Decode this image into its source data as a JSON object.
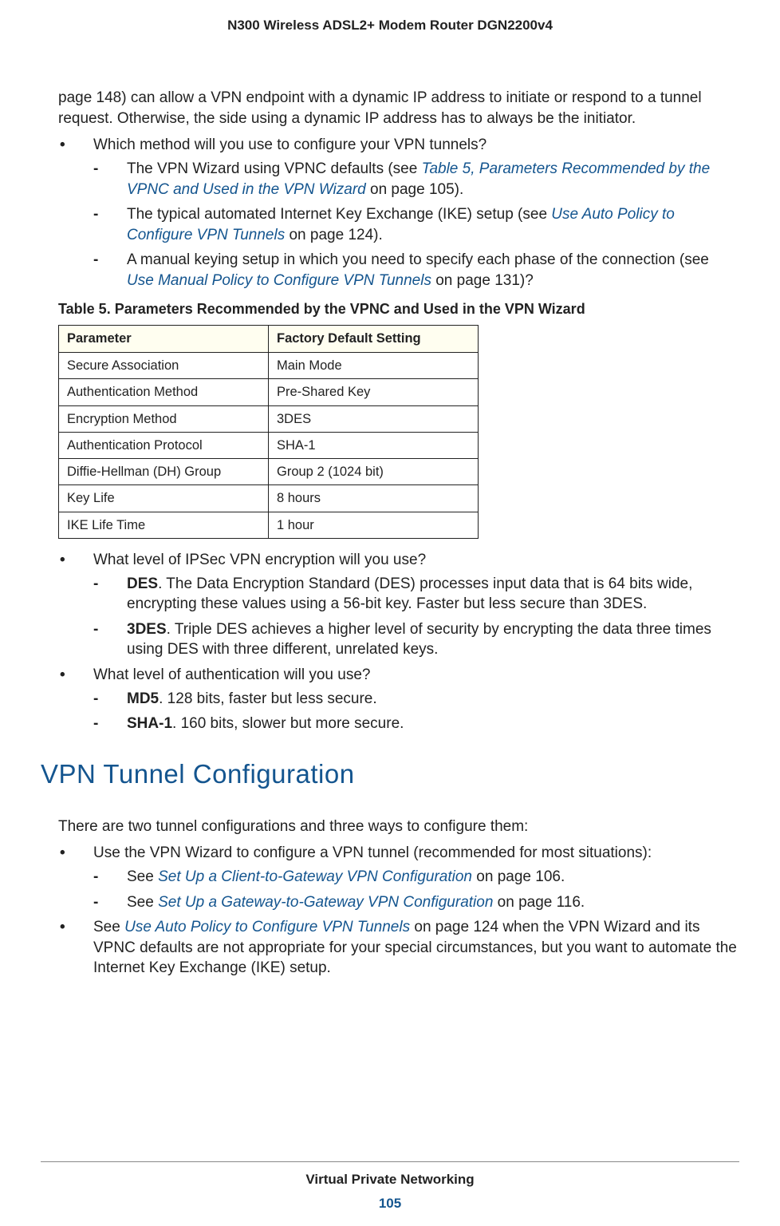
{
  "header": {
    "title": "N300 Wireless ADSL2+ Modem Router DGN2200v4"
  },
  "content": {
    "intro": "page 148) can allow a VPN endpoint with a dynamic IP address to initiate or respond to a tunnel request. Otherwise, the side using a dynamic IP address has to always be the initiator.",
    "q1": "Which method will you use to configure your VPN tunnels?",
    "q1a_pre": "The VPN Wizard using VPNC defaults (see ",
    "q1a_link": "Table 5, Parameters Recommended by the VPNC and Used in the VPN Wizard",
    "q1a_post": " on page 105).",
    "q1b_pre": "The typical automated Internet Key Exchange (IKE) setup (see ",
    "q1b_link": "Use Auto Policy to Configure VPN Tunnels",
    "q1b_post": " on page 124).",
    "q1c_pre": "A manual keying setup in which you need to specify each phase of the connection (see ",
    "q1c_link": "Use Manual Policy to Configure VPN Tunnels",
    "q1c_post": " on page 131)?",
    "table_caption": "Table 5.  Parameters Recommended by the VPNC and Used in the VPN Wizard",
    "table": {
      "headers": [
        "Parameter",
        "Factory Default Setting"
      ],
      "rows": [
        [
          "Secure Association",
          "Main Mode"
        ],
        [
          "Authentication Method",
          "Pre-Shared Key"
        ],
        [
          "Encryption Method",
          "3DES"
        ],
        [
          "Authentication Protocol",
          "SHA-1"
        ],
        [
          "Diffie-Hellman (DH) Group",
          "Group 2 (1024 bit)"
        ],
        [
          "Key Life",
          "8 hours"
        ],
        [
          "IKE Life Time",
          "1 hour"
        ]
      ]
    },
    "q2": "What level of IPSec VPN encryption will you use?",
    "q2a_b": "DES",
    "q2a": ". The Data Encryption Standard (DES) processes input data that is 64 bits wide, encrypting these values using a 56-bit key. Faster but less secure than 3DES.",
    "q2b_b": "3DES",
    "q2b": ". Triple DES achieves a higher level of security by encrypting the data three times using DES with three different, unrelated keys.",
    "q3": "What level of authentication will you use?",
    "q3a_b": "MD5",
    "q3a": ". 128 bits, faster but less secure.",
    "q3b_b": "SHA-1",
    "q3b": ". 160 bits, slower but more secure.",
    "section_title": "VPN Tunnel Configuration",
    "sec_intro": "There are two tunnel configurations and three ways to configure them:",
    "s1": "Use the VPN Wizard to configure a VPN tunnel (recommended for most situations):",
    "s1a_pre": "See ",
    "s1a_link": "Set Up a Client-to-Gateway VPN Configuration",
    "s1a_post": " on page 106.",
    "s1b_pre": "See ",
    "s1b_link": "Set Up a Gateway-to-Gateway VPN Configuration",
    "s1b_post": " on page 116.",
    "s2_pre": "See ",
    "s2_link": "Use Auto Policy to Configure VPN Tunnels",
    "s2_post": " on page 124 when the VPN Wizard and its VPNC defaults are not appropriate for your special circumstances, but you want to automate the Internet Key Exchange (IKE) setup."
  },
  "footer": {
    "section": "Virtual Private Networking",
    "page": "105"
  }
}
